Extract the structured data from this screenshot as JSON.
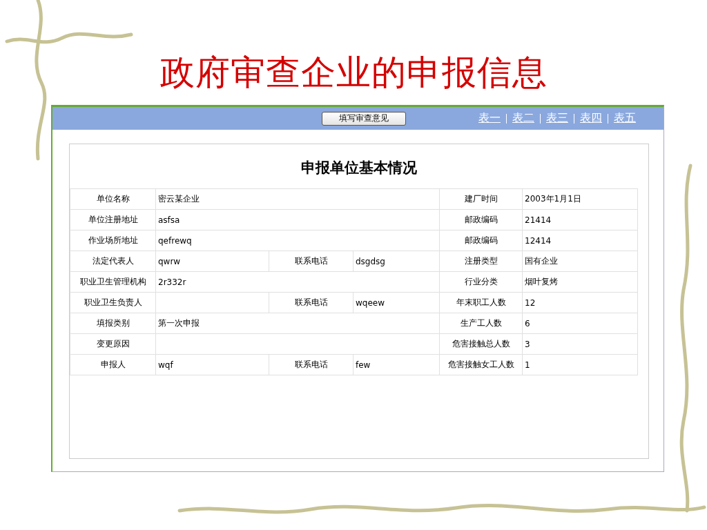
{
  "slide_title": "政府审查企业的申报信息",
  "toolbar": {
    "button": "填写审查意见",
    "links": [
      "表一",
      "表二",
      "表三",
      "表四",
      "表五"
    ]
  },
  "form": {
    "title": "申报单位基本情况",
    "rows": [
      {
        "label": "单位名称",
        "value": "密云某企业",
        "right_label": "建厂时间",
        "right_value": "2003年1月1日"
      },
      {
        "label": "单位注册地址",
        "value": "asfsa",
        "right_label": "邮政编码",
        "right_value": "21414"
      },
      {
        "label": "作业场所地址",
        "value": "qefrewq",
        "right_label": "邮政编码",
        "right_value": "12414"
      },
      {
        "label": "法定代表人",
        "value": "qwrw",
        "contact_label": "联系电话",
        "contact_value": "dsgdsg",
        "right_label": "注册类型",
        "right_value": "国有企业"
      },
      {
        "label": "职业卫生管理机构",
        "value": "2r332r",
        "right_label": "行业分类",
        "right_value": "烟叶复烤"
      },
      {
        "label": "职业卫生负责人",
        "contact_label": "联系电话",
        "contact_value": "wqeew",
        "right_label": "年末职工人数",
        "right_value": "12"
      },
      {
        "label": "填报类别",
        "value": "第一次申报",
        "right_label": "生产工人数",
        "right_value": "6"
      },
      {
        "label": "变更原因",
        "right_label": "危害接触总人数",
        "right_value": "3"
      },
      {
        "label": "申报人",
        "value": "wqf",
        "contact_label": "联系电话",
        "contact_value": "few",
        "right_label": "危害接触女工人数",
        "right_value": "1"
      }
    ]
  }
}
